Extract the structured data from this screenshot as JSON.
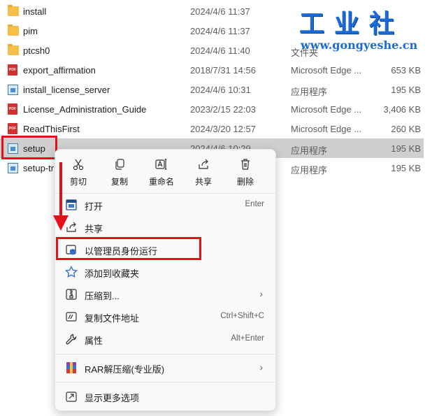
{
  "files": [
    {
      "name": "install",
      "date": "2024/4/6 11:37",
      "type": "",
      "size": "",
      "icon": "folder-icon"
    },
    {
      "name": "pim",
      "date": "2024/4/6 11:37",
      "type": "",
      "size": "",
      "icon": "folder-icon"
    },
    {
      "name": "ptcsh0",
      "date": "2024/4/6 11:40",
      "type": "文件夹",
      "size": "",
      "icon": "folder-icon"
    },
    {
      "name": "export_affirmation",
      "date": "2018/7/31 14:56",
      "type": "Microsoft Edge ...",
      "size": "653 KB",
      "icon": "pdf-icon"
    },
    {
      "name": "install_license_server",
      "date": "2024/4/6 10:31",
      "type": "应用程序",
      "size": "195 KB",
      "icon": "exe-icon"
    },
    {
      "name": "License_Administration_Guide",
      "date": "2023/2/15 22:03",
      "type": "Microsoft Edge ...",
      "size": "3,406 KB",
      "icon": "pdf-icon"
    },
    {
      "name": "ReadThisFirst",
      "date": "2024/3/20 12:57",
      "type": "Microsoft Edge ...",
      "size": "260 KB",
      "icon": "pdf-icon"
    },
    {
      "name": "setup",
      "date": "2024/4/6 10:29",
      "type": "应用程序",
      "size": "195 KB",
      "icon": "exe-icon"
    },
    {
      "name": "setup-tr",
      "date": "",
      "type": "应用程序",
      "size": "195 KB",
      "icon": "exe-icon"
    }
  ],
  "watermark": {
    "title": "工业社",
    "url": "www.gongyeshe.cn"
  },
  "context_menu": {
    "quick_actions": [
      {
        "label": "剪切",
        "icon": "scissors-icon"
      },
      {
        "label": "复制",
        "icon": "copy-icon"
      },
      {
        "label": "重命名",
        "icon": "rename-icon"
      },
      {
        "label": "共享",
        "icon": "share-icon"
      },
      {
        "label": "删除",
        "icon": "trash-icon"
      }
    ],
    "items": [
      {
        "label": "打开",
        "shortcut": "Enter",
        "icon": "open-icon"
      },
      {
        "label": "共享",
        "shortcut": "",
        "icon": "share-icon"
      },
      {
        "label": "以管理员身份运行",
        "shortcut": "",
        "icon": "shield-icon"
      },
      {
        "label": "添加到收藏夹",
        "shortcut": "",
        "icon": "star-icon"
      },
      {
        "label": "压缩到...",
        "shortcut": "",
        "icon": "zip-icon",
        "submenu": true
      },
      {
        "label": "复制文件地址",
        "shortcut": "Ctrl+Shift+C",
        "icon": "copy-path-icon"
      },
      {
        "label": "属性",
        "shortcut": "Alt+Enter",
        "icon": "wrench-icon"
      },
      {
        "label": "RAR解压缩(专业版)",
        "shortcut": "",
        "icon": "rar-icon",
        "submenu": true
      },
      {
        "label": "显示更多选项",
        "shortcut": "",
        "icon": "more-options-icon"
      }
    ],
    "arrow_glyph": "›"
  },
  "colors": {
    "highlight_red": "#e3111a",
    "selected_row": "#cfcfcf",
    "brand_blue": "#1a6bd6"
  }
}
